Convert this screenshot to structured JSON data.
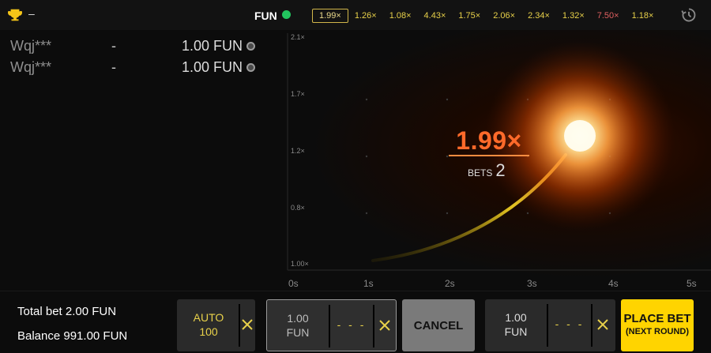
{
  "topbar": {
    "leaderboard_dash": "–",
    "currency": "FUN",
    "history": [
      "1.99×",
      "1.26×",
      "1.08×",
      "4.43×",
      "1.75×",
      "2.06×",
      "2.34×",
      "1.32×",
      "7.50×",
      "1.18×"
    ],
    "history_colors": [
      "#e9d98c",
      "#e8d14a",
      "#e8d14a",
      "#e8d14a",
      "#e8d14a",
      "#e8d14a",
      "#e8d14a",
      "#e8d14a",
      "#e06060",
      "#e8d14a"
    ]
  },
  "bets": [
    {
      "user": "Wqj***",
      "cashout": "-",
      "amount": "1.00 FUN"
    },
    {
      "user": "Wqj***",
      "cashout": "-",
      "amount": "1.00 FUN"
    }
  ],
  "graph": {
    "y_labels": [
      "2.1×",
      "1.7×",
      "1.2×",
      "0.8×",
      "1.00×"
    ],
    "x_labels": [
      "0s",
      "1s",
      "2s",
      "3s",
      "4s",
      "5s"
    ],
    "multiplier": "1.99×",
    "bets_label": "BETS",
    "bets_count": "2"
  },
  "footer": {
    "total_bet": "Total bet 2.00 FUN",
    "balance": "Balance 991.00 FUN",
    "auto_line1": "AUTO",
    "auto_line2": "100",
    "bet1_amount_line1": "1.00",
    "bet1_amount_line2": "FUN",
    "bet1_dashes": "- - -",
    "cancel_label": "CANCEL",
    "bet2_amount_line1": "1.00",
    "bet2_amount_line2": "FUN",
    "bet2_dashes": "- - -",
    "place_bet_line1": "PLACE BET",
    "place_bet_line2": "(NEXT ROUND)"
  },
  "colors": {
    "accent_yellow": "#ffd400",
    "multiplier_orange": "#ff6a2a",
    "status_green": "#22c55e"
  }
}
